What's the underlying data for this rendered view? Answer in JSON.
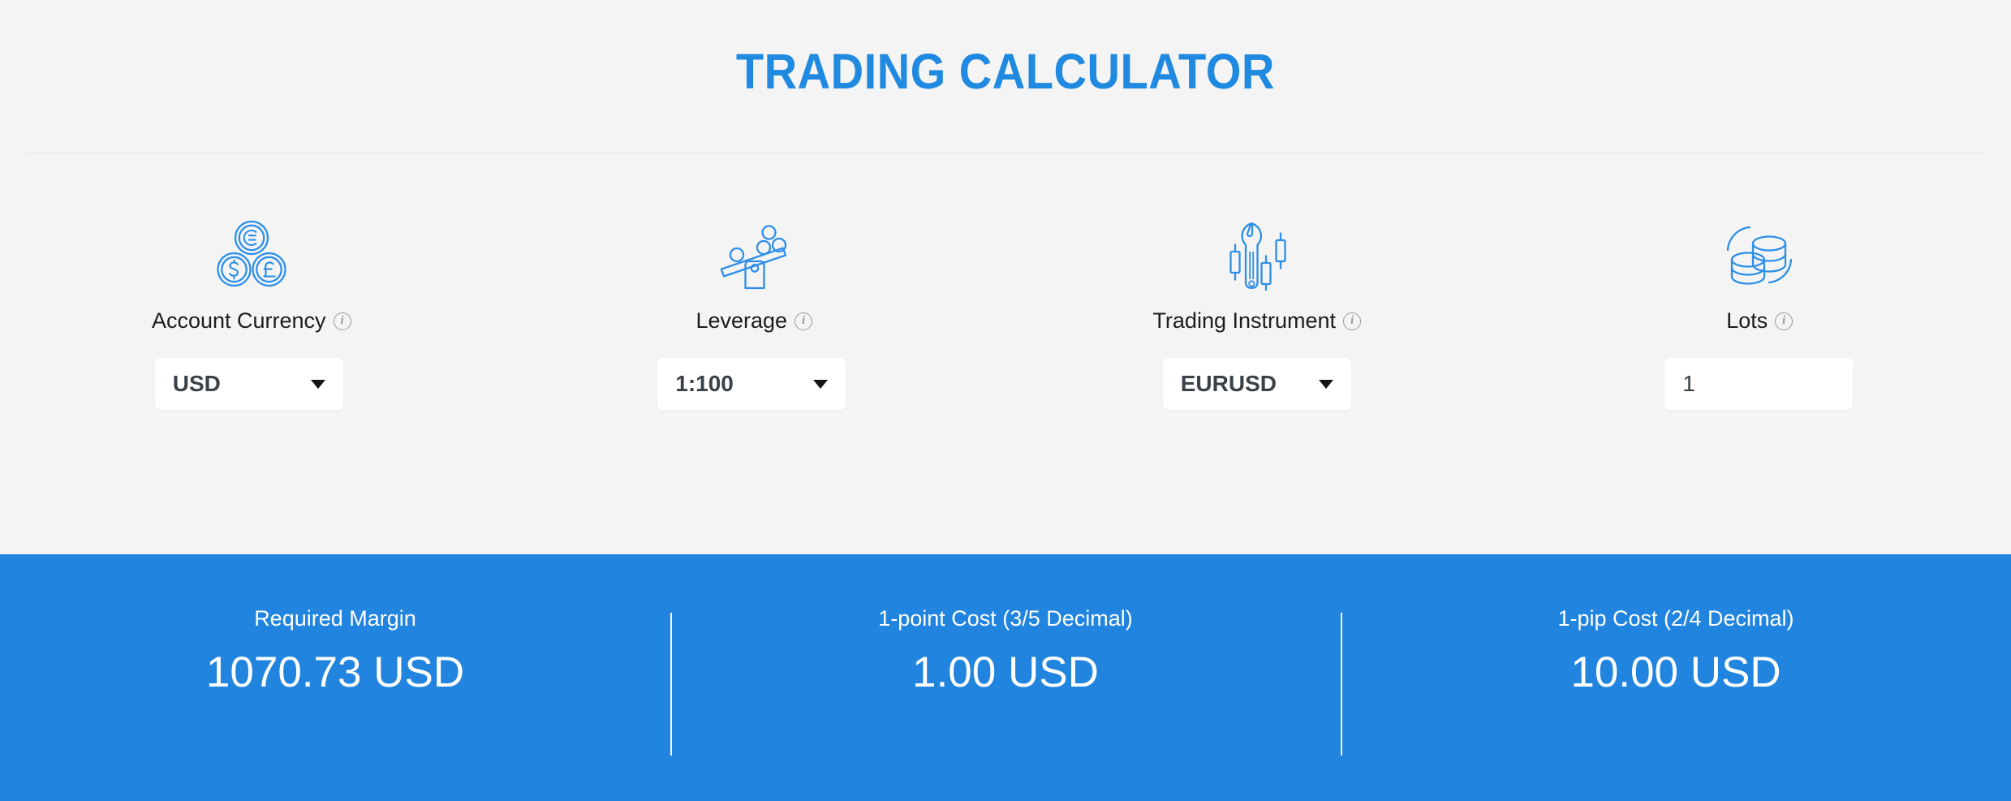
{
  "header": {
    "title": "TRADING CALCULATOR",
    "accent_color": "#2089e0"
  },
  "fields": [
    {
      "icon": "currency-coins-icon",
      "label": "Account Currency",
      "info": "i",
      "control_type": "select",
      "value": "USD"
    },
    {
      "icon": "leverage-seesaw-icon",
      "label": "Leverage",
      "info": "i",
      "control_type": "select",
      "value": "1:100"
    },
    {
      "icon": "wrench-candlestick-icon",
      "label": "Trading Instrument",
      "info": "i",
      "control_type": "select",
      "value": "EURUSD"
    },
    {
      "icon": "coin-stack-icon",
      "label": "Lots",
      "info": "i",
      "control_type": "text-input",
      "value": "1"
    }
  ],
  "results": {
    "background_color": "#2184de",
    "items": [
      {
        "label": "Required Margin",
        "value": "1070.73 USD"
      },
      {
        "label": "1-point Cost (3/5 Decimal)",
        "value": "1.00 USD"
      },
      {
        "label": "1-pip Cost (2/4 Decimal)",
        "value": "10.00 USD"
      }
    ]
  }
}
